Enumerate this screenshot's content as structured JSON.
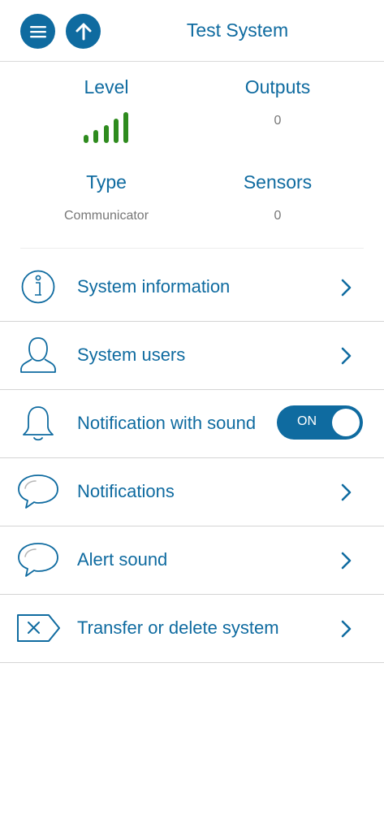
{
  "header": {
    "title": "Test System",
    "menu_icon": "hamburger-menu-icon",
    "up_icon": "arrow-up-icon"
  },
  "stats": {
    "level_label": "Level",
    "level_bars_filled": 5,
    "level_bars_total": 5,
    "outputs_label": "Outputs",
    "outputs_value": "0",
    "type_label": "Type",
    "type_value": "Communicator",
    "sensors_label": "Sensors",
    "sensors_value": "0"
  },
  "menu": {
    "items": [
      {
        "label": "System information",
        "icon": "info-icon"
      },
      {
        "label": "System users",
        "icon": "user-icon"
      },
      {
        "label": "Notification with sound",
        "icon": "bell-icon",
        "toggle": "ON"
      },
      {
        "label": "Notifications",
        "icon": "speech-bubble-icon"
      },
      {
        "label": "Alert sound",
        "icon": "speech-bubble-icon"
      },
      {
        "label": "Transfer or delete system",
        "icon": "delete-tag-icon"
      }
    ]
  },
  "colors": {
    "primary": "#0f6ba0",
    "signal": "#2e8b1e",
    "muted_text": "#777777"
  }
}
